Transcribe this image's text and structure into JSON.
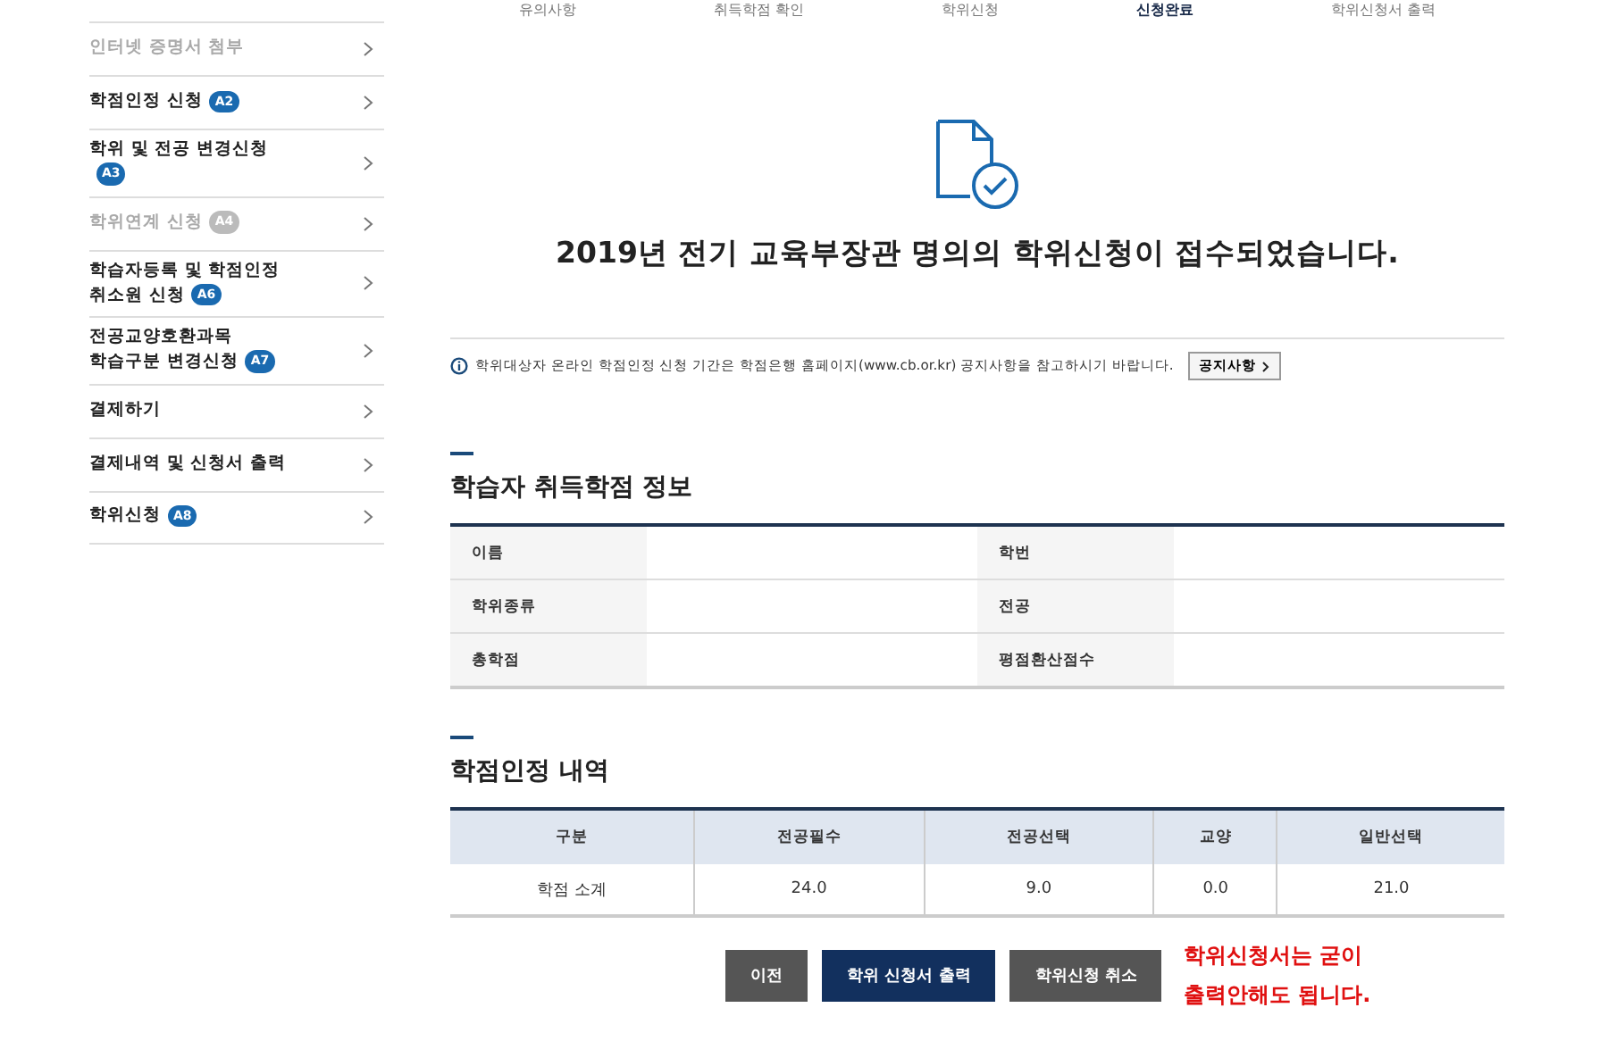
{
  "sidebar": {
    "items": [
      {
        "label": "인터넷 증명서 첨부",
        "disabled": true
      },
      {
        "label": "학점인정 신청",
        "badge": "A2",
        "disabled": false
      },
      {
        "label": "학위 및 전공 변경신청",
        "badge": "A3",
        "disabled": false
      },
      {
        "label": "학위연계 신청",
        "badge": "A4",
        "disabled": true
      },
      {
        "label": "학습자등록 및 학점인정 취소원 신청",
        "badge": "A6",
        "disabled": false
      },
      {
        "label": "전공교양호환과목 학습구분 변경신청",
        "badge": "A7",
        "disabled": false
      },
      {
        "label": "결제하기",
        "disabled": false
      },
      {
        "label": "결제내역 및 신청서 출력",
        "disabled": false
      },
      {
        "label": "학위신청",
        "badge": "A8",
        "disabled": false
      }
    ]
  },
  "steps": [
    {
      "label": "유의사항",
      "selected": false
    },
    {
      "label": "취득학점 확인",
      "selected": false
    },
    {
      "label": "학위신청",
      "selected": false
    },
    {
      "label": "신청완료",
      "selected": true
    },
    {
      "label": "학위신청서 출력",
      "selected": false
    }
  ],
  "headline": "2019년 전기 교육부장관 명의의 학위신청이 접수되었습니다.",
  "notice": {
    "text": "학위대상자 온라인 학점인정 신청 기간은 학점은행 홈페이지(www.cb.or.kr) 공지사항을 참고하시기 바랍니다.",
    "button": "공지사항"
  },
  "learner_info": {
    "title": "학습자 취득학점 정보",
    "rows": [
      [
        "이름",
        "학번"
      ],
      [
        "학위종류",
        "전공"
      ],
      [
        "총학점",
        "평점환산점수"
      ]
    ]
  },
  "credits": {
    "title": "학점인정 내역",
    "columns": [
      "구분",
      "전공필수",
      "전공선택",
      "교양",
      "일반선택"
    ],
    "rows": [
      [
        "학점 소계",
        "24.0",
        "9.0",
        "0.0",
        "21.0"
      ]
    ]
  },
  "buttons": [
    {
      "label": "이전",
      "kind": "gray"
    },
    {
      "label": "학위 신청서 출력",
      "kind": "navy"
    },
    {
      "label": "학위신청 취소",
      "kind": "gray"
    }
  ],
  "annotation": [
    "학위신청서는 굳이",
    "출력안해도 됩니다."
  ]
}
